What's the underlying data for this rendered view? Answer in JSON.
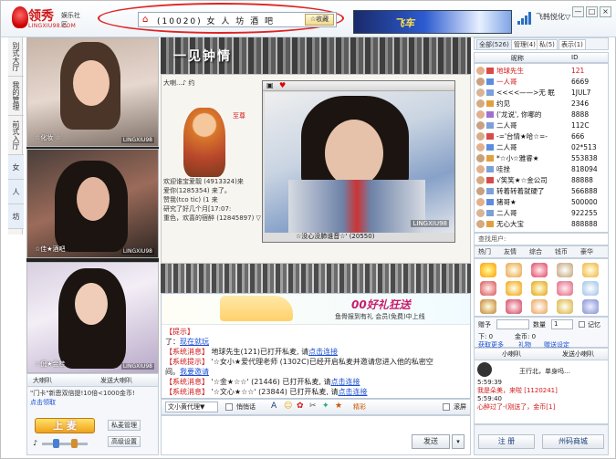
{
  "app": {
    "logo_main": "领秀",
    "logo_sub": "娱乐社区",
    "logo_url": "LINGXIU98.COM",
    "room_title": "(10020) 女 人 坊 酒 吧",
    "fav_label": "☆收藏",
    "banner_text": "飞车",
    "user_menu": "飞韩悦化▽",
    "window_buttons": [
      "—",
      "□",
      "×"
    ]
  },
  "left_tabs": [
    "别式大厅",
    "我的管理",
    "前式入厅",
    "女",
    "人",
    "坊"
  ],
  "cams": [
    {
      "caption": "☆化妆 ☆",
      "watermark": "LINGXIU98"
    },
    {
      "caption": "☆佳★酒吧",
      "watermark": "LINGXIU98"
    },
    {
      "caption": "☆倪★金桂",
      "watermark": "LINGXIU98"
    }
  ],
  "left_bottom": {
    "tab1": "大喇叭",
    "tab2": "发送大喇叭",
    "line1": "\"门卡\"新恩双倍提!10倍<1000金币!",
    "line2": "点击领取",
    "shangmai": "上 麦",
    "btn_private": "私麦管理",
    "btn_settings": "高级设置"
  },
  "stage": {
    "top_strip_text": "一见钟情",
    "side_chat": [
      "大喇...♪ 约",
      "至尊",
      "欢迎谁宝爱靓 (4913324)来",
      "爱你(1285354) 来了。",
      "赞我(tco tic) (1 来",
      "研究了好几个月[17:07:",
      "重色，欢喜的宿醉 (12845897) ▽"
    ],
    "video_caption": "☆没心没肺谁音☆' (20550)",
    "video_watermark": "LINGXIU98"
  },
  "chat": {
    "ad_text": "00好礼狂送",
    "ad_sub": "鱼骨报到有礼  会员(免费)中上线",
    "lines": [
      {
        "tag": "【提示】",
        "text": "",
        "link": ""
      },
      {
        "tag": "了：",
        "text": "现在就玩",
        "link": ""
      },
      {
        "tag": "【系统消息】",
        "text": " 地球先生(121)已打开私麦, 请",
        "link": "点击连接"
      },
      {
        "tag": "【系统提示】",
        "text": " '☆女小★爱代理老师 (1302C)已经开启私麦并邀请您进入他的私密空",
        "link": ""
      },
      {
        "tag": "间。",
        "text": "",
        "link": "我要邀请"
      },
      {
        "tag": "【系统消息】",
        "text": " '☆金★☆☆' (21446) 已打开私麦, 请",
        "link": "点击连接"
      },
      {
        "tag": "【系统消息】",
        "text": " '☆文心★☆☆' (23844) 已打开私麦, 请",
        "link": "点击连接"
      }
    ],
    "target": "文小黄代理▼",
    "whisper": "悄悄话",
    "feature": "精彩",
    "send": "发送",
    "screen": "滚屏"
  },
  "right": {
    "tabs": [
      "全部(526)",
      "管理(4)",
      "私(5)",
      "表示(1)"
    ],
    "col_name": "昵称",
    "col_id": "ID",
    "users": [
      {
        "name": "地球先生",
        "id": "121",
        "av": "#e2b08c",
        "badge": "#d84b4b"
      },
      {
        "name": "一人哥",
        "id": "6669",
        "av": "#c9a080",
        "badge": "#5a8de0"
      },
      {
        "name": "<<<<——>无 眠",
        "id": "1JUL7",
        "av": "#d9b494",
        "badge": "#7ca0d8"
      },
      {
        "name": "约见",
        "id": "2346",
        "av": "#d6aa80",
        "badge": "#e0a040"
      },
      {
        "name": "('龙说', 你哪的",
        "id": "8888",
        "av": "#e2b08c",
        "badge": "#a070d0"
      },
      {
        "name": "二人哥",
        "id": "112C",
        "av": "#c9a080",
        "badge": "#7ca0d8"
      },
      {
        "name": "-='台情★哈☆=-",
        "id": "666",
        "av": "#d8ac88",
        "badge": "#d84b4b"
      },
      {
        "name": "二人哥",
        "id": "02*513",
        "av": "#e2b08c",
        "badge": "#5a8de0"
      },
      {
        "name": "*☆小☆雅睿★",
        "id": "553838",
        "av": "#caa07a",
        "badge": "#e0a040"
      },
      {
        "name": "哇挫",
        "id": "818094",
        "av": "#e2b08c",
        "badge": "#7ca0d8"
      },
      {
        "name": "√笑笑★☆金公司",
        "id": "88888",
        "av": "#d6aa80",
        "badge": "#d84b4b"
      },
      {
        "name": "转着转着就硬了",
        "id": "566888",
        "av": "#c9a080",
        "badge": "#7ca0d8"
      },
      {
        "name": "猪哥★",
        "id": "500000",
        "av": "#e2b08c",
        "badge": "#5a8de0"
      },
      {
        "name": "二人哥",
        "id": "922255",
        "av": "#d9b494",
        "badge": "#7ca0d8"
      },
      {
        "name": "无心大宝",
        "id": "888888",
        "av": "#d6aa80",
        "badge": "#e0a040"
      }
    ],
    "search_label": "查找用户:",
    "gift_tabs": [
      "热门",
      "友情",
      "综合",
      "钱币",
      "豪华"
    ],
    "gift_qty_label": "赠予",
    "gift_num_label": "数量",
    "gift_num_value": "1",
    "gift_memo": "记忆",
    "gift_money": "下: 0",
    "gift_deposit": "金币: 0",
    "gift_links": [
      "获取更多",
      "礼物",
      "赠送设定"
    ],
    "horn_tab": "小喇叭",
    "horn_send": "发送小喇叭",
    "horn_lines": [
      "王行北，单身吗…",
      "5:59:39",
      "我是朵美，来啦 [1120241]",
      "5:59:40",
      "心醉过了-(刚送了，金币[1]"
    ],
    "btn_register": "注 册",
    "btn_shop": "州码商城"
  },
  "colors": {
    "accent_red": "#d01818",
    "link_blue": "#1a4fd0",
    "panel_border": "#c4cfdc"
  }
}
